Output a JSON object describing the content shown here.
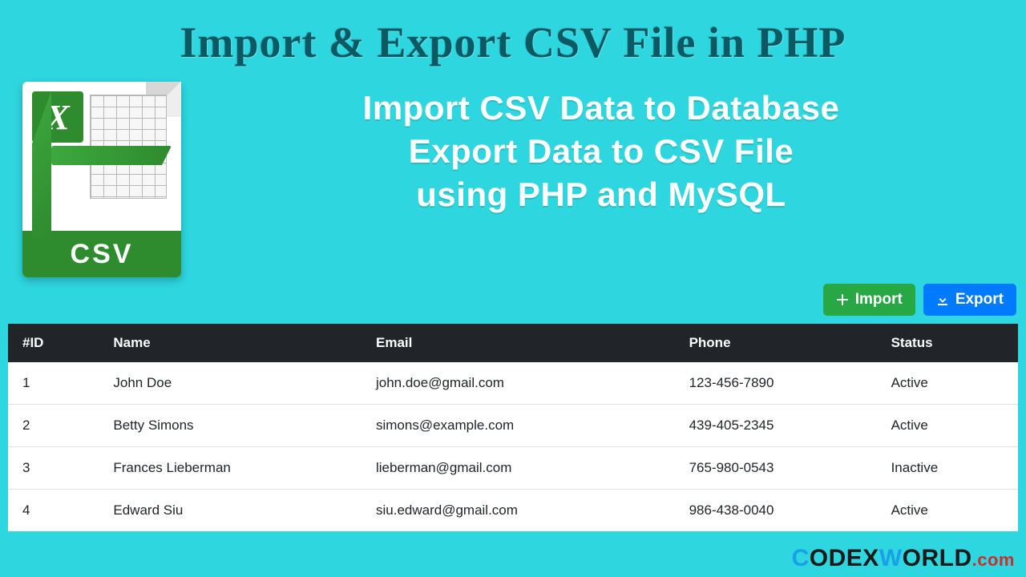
{
  "header": {
    "title": "Import & Export CSV File in PHP",
    "subtitle_lines": [
      "Import CSV Data to Database",
      "Export Data to CSV File",
      "using PHP and MySQL"
    ]
  },
  "icon": {
    "excel_letter": "X",
    "band_label": "CSV"
  },
  "toolbar": {
    "import_label": "Import",
    "export_label": "Export"
  },
  "table": {
    "columns": [
      "#ID",
      "Name",
      "Email",
      "Phone",
      "Status"
    ],
    "rows": [
      {
        "id": "1",
        "name": "John Doe",
        "email": "john.doe@gmail.com",
        "phone": "123-456-7890",
        "status": "Active"
      },
      {
        "id": "2",
        "name": "Betty Simons",
        "email": "simons@example.com",
        "phone": "439-405-2345",
        "status": "Active"
      },
      {
        "id": "3",
        "name": "Frances Lieberman",
        "email": "lieberman@gmail.com",
        "phone": "765-980-0543",
        "status": "Inactive"
      },
      {
        "id": "4",
        "name": "Edward Siu",
        "email": "siu.edward@gmail.com",
        "phone": "986-438-0040",
        "status": "Active"
      }
    ]
  },
  "watermark": {
    "part1": "C",
    "part2": "ODEX",
    "part3": "W",
    "part4": "ORLD",
    "suffix": ".com"
  }
}
